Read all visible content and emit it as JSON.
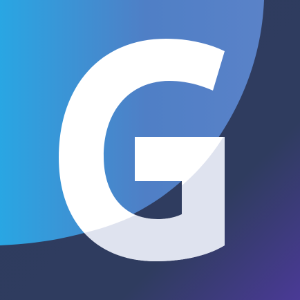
{
  "logo": {
    "letter": "G",
    "icon_name": "g-logo-icon"
  },
  "colors": {
    "background": "#2f3c5f",
    "background_accent": "#4a3a96",
    "arc_left": "#29a6e3",
    "arc_right": "#4f7fc6",
    "letter_light": "#ffffff",
    "letter_shade": "#dde2ee"
  }
}
